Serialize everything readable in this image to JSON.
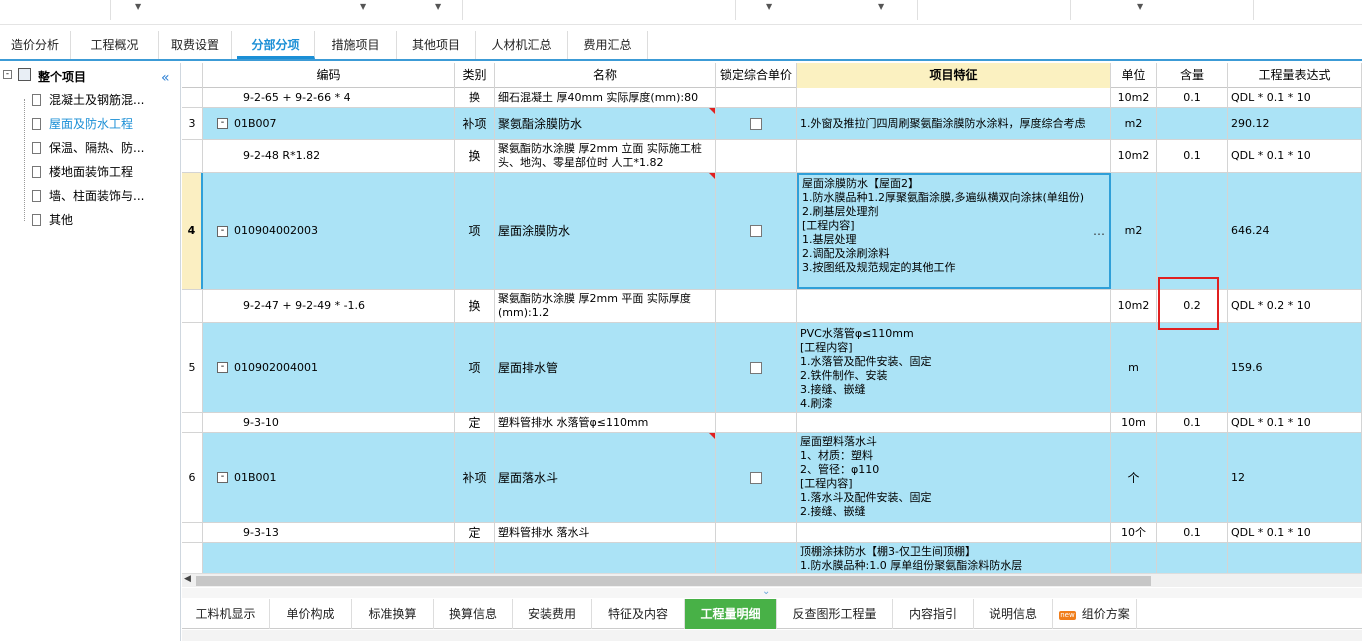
{
  "top_tabs": [
    {
      "label": "造价分析"
    },
    {
      "label": "工程概况"
    },
    {
      "label": "取费设置"
    },
    {
      "label": "分部分项"
    },
    {
      "label": "措施项目"
    },
    {
      "label": "其他项目"
    },
    {
      "label": "人材机汇总"
    },
    {
      "label": "费用汇总"
    }
  ],
  "sidebar": {
    "root": "整个项目",
    "items": [
      {
        "label": "混凝土及钢筋混..."
      },
      {
        "label": "屋面及防水工程"
      },
      {
        "label": "保温、隔热、防..."
      },
      {
        "label": "楼地面装饰工程"
      },
      {
        "label": "墙、柱面装饰与..."
      },
      {
        "label": "其他"
      }
    ]
  },
  "grid": {
    "headers": {
      "code": "编码",
      "type": "类别",
      "name": "名称",
      "lock": "锁定综合单价",
      "feature": "项目特征",
      "unit": "单位",
      "qty": "含量",
      "expr": "工程量表达式"
    },
    "rows": [
      {
        "num": "",
        "code": "9-2-65 + 9-2-66 * 4",
        "type": "换",
        "name": "细石混凝土 厚40mm  实际厚度(mm):80",
        "feature": "",
        "unit": "10m2",
        "qty": "0.1",
        "expr": "QDL * 0.1 * 10"
      },
      {
        "num": "3",
        "code": "01B007",
        "type": "补项",
        "name": "聚氨酯涂膜防水",
        "feature": "1.外窗及推拉门四周刷聚氨酯涂膜防水涂料，厚度综合考虑",
        "unit": "m2",
        "qty": "",
        "expr": "290.12"
      },
      {
        "num": "",
        "code": "9-2-48 R*1.82",
        "type": "换",
        "name": "聚氨酯防水涂膜 厚2mm 立面  实际施工桩头、地沟、零星部位时 人工*1.82",
        "feature": "",
        "unit": "10m2",
        "qty": "0.1",
        "expr": "QDL * 0.1 * 10"
      },
      {
        "num": "4",
        "code": "010904002003",
        "type": "项",
        "name": "屋面涂膜防水",
        "feature": "屋面涂膜防水【屋面2】\n1.防水膜品种1.2厚聚氨酯涂膜,多遍纵横双向涂抹(单组份)\n2.刷基层处理剂\n[工程内容]\n1.基层处理\n2.调配及涂刷涂料\n3.按图纸及规范规定的其他工作",
        "unit": "m2",
        "qty": "",
        "expr": "646.24"
      },
      {
        "num": "",
        "code": "9-2-47 + 9-2-49 * -1.6",
        "type": "换",
        "name": "聚氨酯防水涂膜 厚2mm 平面  实际厚度(mm):1.2",
        "feature": "",
        "unit": "10m2",
        "qty": "0.2",
        "expr": "QDL * 0.2 * 10"
      },
      {
        "num": "5",
        "code": "010902004001",
        "type": "项",
        "name": "屋面排水管",
        "feature": "PVC水落管φ≤110mm\n[工程内容]\n1.水落管及配件安装、固定\n2.铁件制作、安装\n3.接缝、嵌缝\n4.刷漆",
        "unit": "m",
        "qty": "",
        "expr": "159.6"
      },
      {
        "num": "",
        "code": "9-3-10",
        "type": "定",
        "name": "塑料管排水 水落管φ≤110mm",
        "feature": "",
        "unit": "10m",
        "qty": "0.1",
        "expr": "QDL * 0.1 * 10"
      },
      {
        "num": "6",
        "code": "01B001",
        "type": "补项",
        "name": "屋面落水斗",
        "feature": "屋面塑料落水斗\n1、材质：塑料\n2、管径：φ110\n[工程内容]\n1.落水斗及配件安装、固定\n2.接缝、嵌缝",
        "unit": "个",
        "qty": "",
        "expr": "12"
      },
      {
        "num": "",
        "code": "9-3-13",
        "type": "定",
        "name": "塑料管排水 落水斗",
        "feature": "",
        "unit": "10个",
        "qty": "0.1",
        "expr": "QDL * 0.1 * 10"
      },
      {
        "num": "",
        "code": "",
        "type": "",
        "name": "",
        "feature": "顶棚涂抹防水【棚3-仅卫生间顶棚】\n1.防水膜品种:1.0 厚单组份聚氨酯涂料防水层",
        "unit": "",
        "qty": "",
        "expr": ""
      }
    ]
  },
  "bottom_tabs": [
    {
      "label": "工料机显示"
    },
    {
      "label": "单价构成"
    },
    {
      "label": "标准换算"
    },
    {
      "label": "换算信息"
    },
    {
      "label": "安装费用"
    },
    {
      "label": "特征及内容"
    },
    {
      "label": "工程量明细"
    },
    {
      "label": "反查图形工程量"
    },
    {
      "label": "内容指引"
    },
    {
      "label": "说明信息"
    },
    {
      "label": "组价方案"
    }
  ],
  "colors": {
    "accent": "#1b8fd6",
    "row_highlight": "#abe3f6",
    "feature_header": "#fbf1c1",
    "active_bottom_tab": "#48b147",
    "annotation": "#e02020"
  }
}
